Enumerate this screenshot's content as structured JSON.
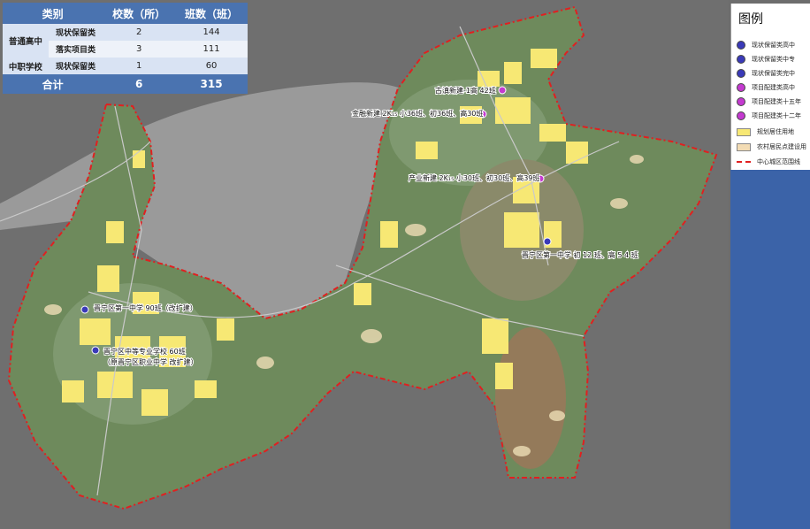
{
  "table": {
    "headers": [
      "类别",
      "校数（所）",
      "班数（班）"
    ],
    "rows": [
      {
        "category": "普通高中",
        "type": "现状保留类",
        "schools": "2",
        "classes": "144"
      },
      {
        "category": "",
        "type": "落实项目类",
        "schools": "3",
        "classes": "111"
      },
      {
        "category": "中职学校",
        "type": "现状保留类",
        "schools": "1",
        "classes": "60"
      }
    ],
    "total": {
      "label": "合计",
      "schools": "6",
      "classes": "315"
    }
  },
  "legend": {
    "title": "图例",
    "items": [
      {
        "label": "现状保留类高中",
        "symbol": "circle",
        "color": "#3a3ab8"
      },
      {
        "label": "现状保留类中专",
        "symbol": "circle",
        "color": "#3a3ab8"
      },
      {
        "label": "现状保留类完中",
        "symbol": "circle",
        "color": "#3a3ab8"
      },
      {
        "label": "项目配建类高中",
        "symbol": "circle",
        "color": "#c43ad0"
      },
      {
        "label": "项目配建类十五年",
        "symbol": "circle",
        "color": "#c43ad0"
      },
      {
        "label": "项目配建类十二年",
        "symbol": "circle",
        "color": "#c43ad0"
      },
      {
        "label": "规划居住用地",
        "symbol": "rect",
        "color": "#f7e874"
      },
      {
        "label": "农村居民点建设用",
        "symbol": "rect",
        "color": "#f3dcb4"
      },
      {
        "label": "中心城区范围线",
        "symbol": "line",
        "color": "#e02020"
      }
    ]
  },
  "labels": {
    "gudian": "古滇新建-1高  42班",
    "jinrong": "金融新建  2K₁₅  小36班、初36班、高30班",
    "chanye": "产业新建  2K₁₅  小30班、初30班、高39班",
    "jinning1": "晋宁区第一中学  初 12 班、高 5 4 班",
    "erzhong": "晋宁区第一中学  90班（改扩建）",
    "zhongzhuan1": "晋宁区中等专业学校  60班",
    "zhongzhuan2": "（原晋宁区职业中学  改扩建）"
  },
  "colors": {
    "residential": "#f7e874",
    "rural": "#e8d8b0",
    "boundary": "#e02020",
    "header": "#4a73b0"
  }
}
